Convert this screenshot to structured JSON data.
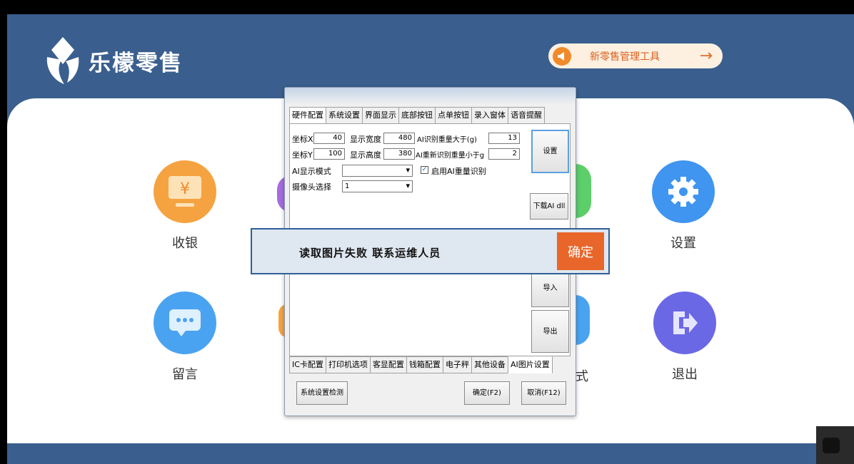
{
  "brand": {
    "name": "乐檬零售",
    "color": "#3a5f8e"
  },
  "promo": {
    "label": "新零售管理工具",
    "arrow": "→"
  },
  "tiles": [
    {
      "label": "收银",
      "icon": "yen-monitor-icon",
      "color": "#f5a340"
    },
    {
      "label": "设置",
      "icon": "gear-icon",
      "color": "#3f95ef"
    },
    {
      "label": "留言",
      "icon": "chat-bubble-icon",
      "color": "#4aa3f0"
    },
    {
      "label": "退出",
      "icon": "exit-icon",
      "color": "#6b68e6"
    }
  ],
  "partial_label": "式",
  "dialog": {
    "top_tabs": [
      "硬件配置",
      "系统设置",
      "界面显示",
      "底部按钮",
      "点单按钮",
      "录入窗体",
      "语音提醒"
    ],
    "bottom_tabs": [
      "IC卡配置",
      "打印机选项",
      "客显配置",
      "钱箱配置",
      "电子秤",
      "其他设备",
      "AI图片设置"
    ],
    "fields": {
      "coord_x_label": "坐标X",
      "coord_x": "40",
      "coord_y_label": "坐标Y",
      "coord_y": "100",
      "width_label": "显示宽度",
      "width": "480",
      "height_label": "显示高度",
      "height": "380",
      "ai_weight_gt_label": "AI识别重量大于(g)",
      "ai_weight_gt": "13",
      "ai_reweigh_lt_label": "AI重新识别重量小于g",
      "ai_reweigh_lt": "2",
      "ai_mode_label": "AI显示模式",
      "ai_mode": "",
      "camera_label": "摄像头选择",
      "camera": "1",
      "reweigh_enable_label": "启用AI重量识别"
    },
    "buttons": {
      "setup": "设置",
      "download": "下载AI dll",
      "import": "导入",
      "export": "导出",
      "check": "系统设置检测",
      "ok": "确定(F2)",
      "cancel": "取消(F12)"
    }
  },
  "alert": {
    "message": "读取图片失败  联系运维人员",
    "ok": "确定"
  }
}
